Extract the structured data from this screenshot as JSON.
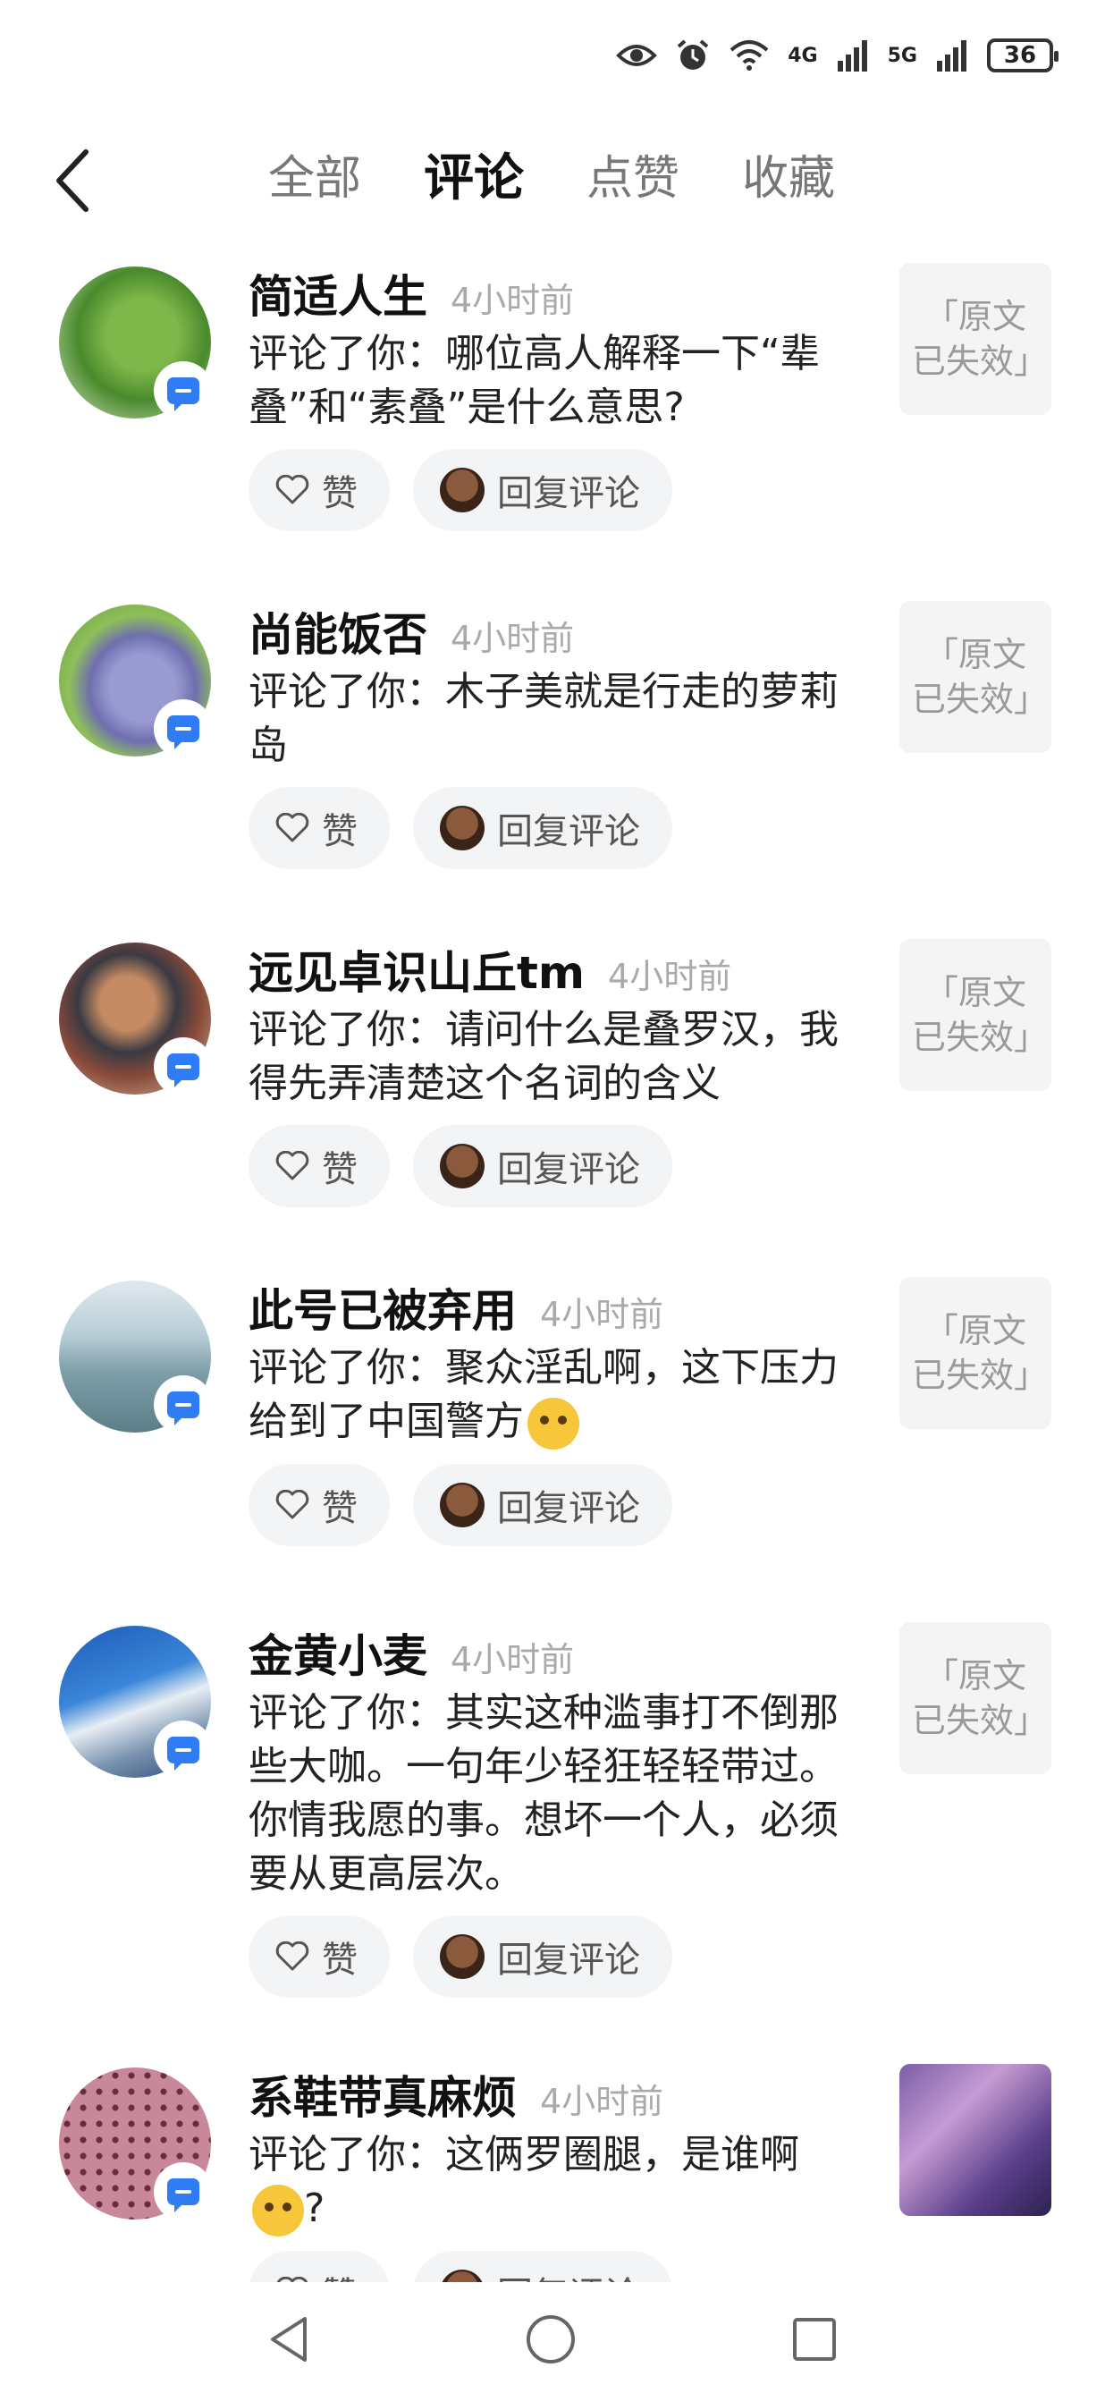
{
  "status_bar": {
    "network_1": "4G",
    "network_2": "5G",
    "battery": "36",
    "icons": [
      "eye-icon",
      "alarm-icon",
      "wifi-icon",
      "signal-icon",
      "signal-icon",
      "battery-icon"
    ]
  },
  "header": {
    "back_icon": "chevron-left-icon",
    "tabs": [
      {
        "label": "全部",
        "active": false
      },
      {
        "label": "评论",
        "active": true
      },
      {
        "label": "点赞",
        "active": false
      },
      {
        "label": "收藏",
        "active": false
      }
    ]
  },
  "labels": {
    "like": "赞",
    "reply": "回复评论",
    "invalid": "「原文已失效」"
  },
  "comments": [
    {
      "name": "简适人生",
      "time": "4小时前",
      "text": "评论了你：哪位高人解释一下“辈叠”和“素叠”是什么意思?",
      "thumb": "「原文已失效」"
    },
    {
      "name": "尚能饭否",
      "time": "4小时前",
      "text": "评论了你：木子美就是行走的萝莉岛",
      "thumb": "「原文已失效」"
    },
    {
      "name": "远见卓识山丘tm",
      "time": "4小时前",
      "text": "评论了你：请问什么是叠罗汉，我得先弄清楚这个名词的含义",
      "thumb": "「原文已失效」"
    },
    {
      "name": "此号已被弃用",
      "time": "4小时前",
      "text": "评论了你：聚众淫乱啊，这下压力给到了中国警方",
      "emoji": "thinking-emoji",
      "thumb": "「原文已失效」"
    },
    {
      "name": "金黄小麦",
      "time": "4小时前",
      "text": "评论了你：其实这种滥事打不倒那些大咖。一句年少轻狂轻轻带过。你情我愿的事。想坏一个人，必须要从更高层次。",
      "thumb": "「原文已失效」"
    },
    {
      "name": "系鞋带真麻烦",
      "time": "4小时前",
      "text": "评论了你：这俩罗圈腿，是谁啊",
      "text_tail": "?",
      "emoji": "crying-emoji"
    }
  ],
  "nav_bar": [
    "back-triangle-icon",
    "home-circle-icon",
    "recents-square-icon"
  ]
}
